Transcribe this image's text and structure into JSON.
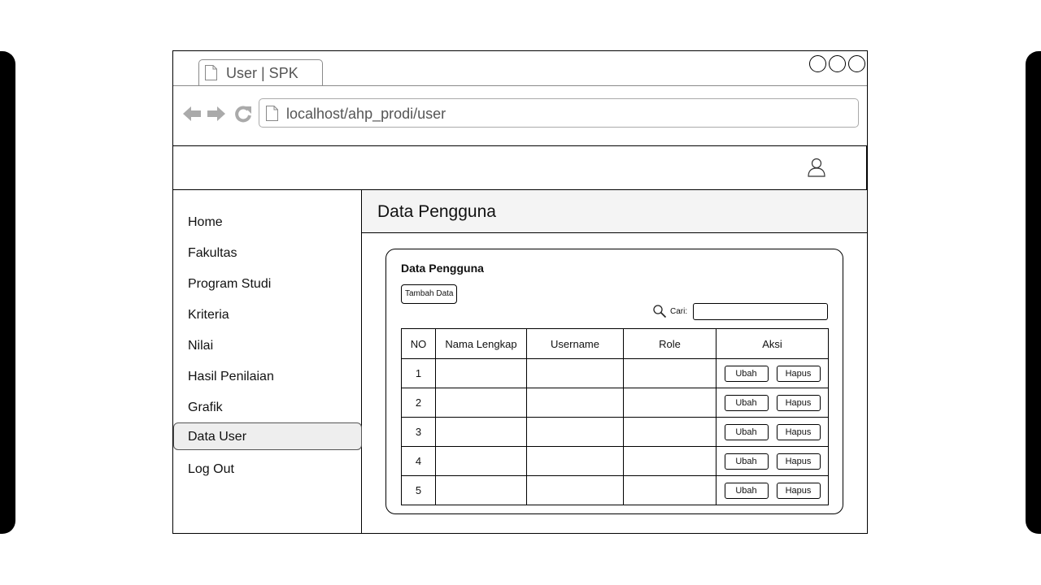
{
  "browser": {
    "tab_title": "User | SPK",
    "url": "localhost/ahp_prodi/user"
  },
  "sidebar": {
    "items": [
      {
        "label": "Home",
        "key": "home"
      },
      {
        "label": "Fakultas",
        "key": "fakultas"
      },
      {
        "label": "Program Studi",
        "key": "program-studi"
      },
      {
        "label": "Kriteria",
        "key": "kriteria"
      },
      {
        "label": "Nilai",
        "key": "nilai"
      },
      {
        "label": "Hasil Penilaian",
        "key": "hasil-penilaian"
      },
      {
        "label": "Grafik",
        "key": "grafik"
      },
      {
        "label": "Data User",
        "key": "data-user",
        "active": true
      },
      {
        "label": "Log Out",
        "key": "log-out"
      }
    ]
  },
  "main": {
    "page_title": "Data Pengguna",
    "card_title": "Data Pengguna",
    "add_button": "Tambah Data",
    "search_label": "Cari:",
    "search_value": "",
    "table": {
      "headers": [
        "NO",
        "Nama Lengkap",
        "Username",
        "Role",
        "Aksi"
      ],
      "rows": [
        {
          "no": "1",
          "nama": "",
          "username": "",
          "role": ""
        },
        {
          "no": "2",
          "nama": "",
          "username": "",
          "role": ""
        },
        {
          "no": "3",
          "nama": "",
          "username": "",
          "role": ""
        },
        {
          "no": "4",
          "nama": "",
          "username": "",
          "role": ""
        },
        {
          "no": "5",
          "nama": "",
          "username": "",
          "role": ""
        }
      ],
      "edit_label": "Ubah",
      "delete_label": "Hapus"
    }
  },
  "icons": {
    "tab": "document-icon",
    "back": "back-arrow-icon",
    "forward": "forward-arrow-icon",
    "reload": "reload-icon",
    "user": "user-icon",
    "search": "search-icon"
  }
}
